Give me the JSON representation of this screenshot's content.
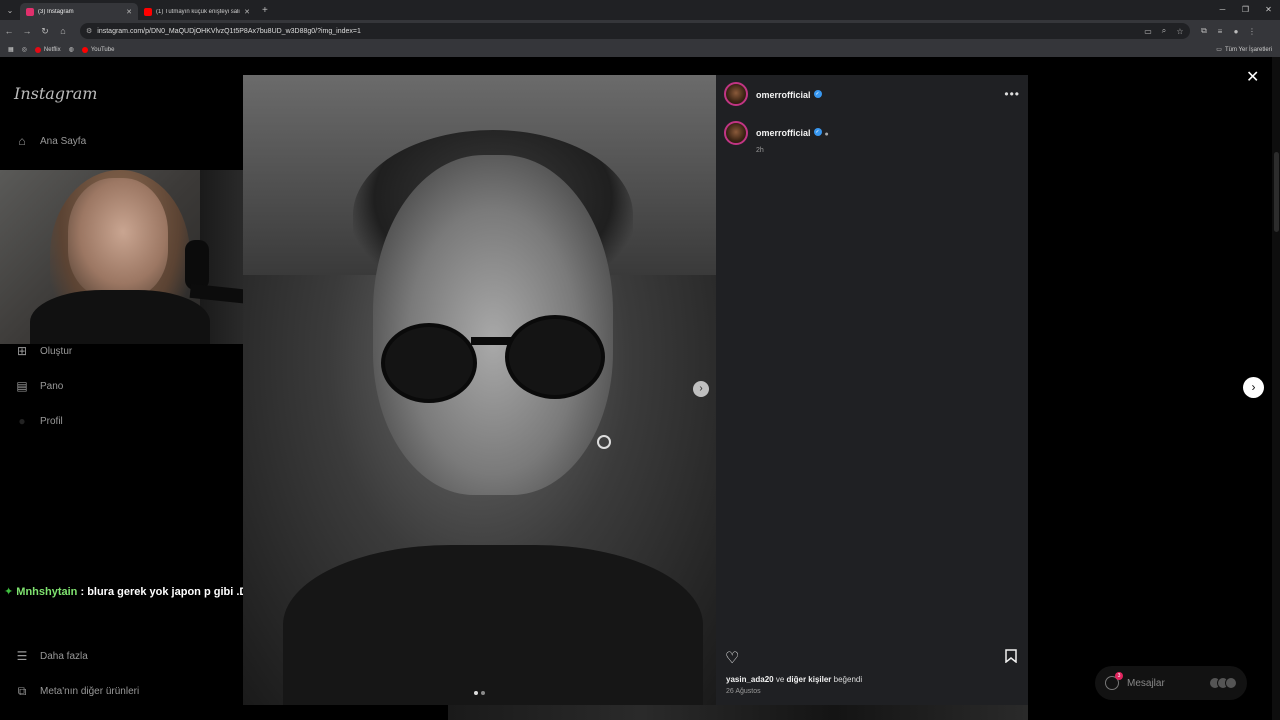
{
  "browser": {
    "tabs": [
      {
        "title": "(3) Instagram",
        "color": "#e1306c"
      },
      {
        "title": "(1) Tutmayın küçük enişteyi sali",
        "color": "#ff0000"
      }
    ],
    "url": "instagram.com/p/DN0_MaQUDjOHKVlvzQ1t5P8Ax7bu8UD_w3D88g0/?img_index=1",
    "bookmarks": [
      {
        "label": "Netflix",
        "color": "#e50914"
      },
      {
        "label": "YouTube",
        "color": "#ff0000"
      }
    ],
    "all_bookmarks": "Tüm Yer İşaretleri"
  },
  "sidebar": {
    "logo": "Instagram",
    "items": [
      {
        "label": "Ana Sayfa",
        "icon": "home-icon"
      },
      {
        "label": "Oluştur",
        "icon": "plus-icon"
      },
      {
        "label": "Pano",
        "icon": "dashboard-icon"
      },
      {
        "label": "Profil",
        "icon": "profile-icon"
      },
      {
        "label": "Daha fazla",
        "icon": "menu-icon"
      },
      {
        "label": "Meta'nın diğer ürünleri",
        "icon": "meta-icon"
      }
    ]
  },
  "chat": {
    "user": "Mnhshytain",
    "message": ": blura gerek yok japon p gibi .D"
  },
  "post": {
    "username": "omerrofficial",
    "caption_username": "omerrofficial",
    "time": "2h",
    "likes_user": "yasin_ada20",
    "likes_mid": " ve ",
    "likes_others": "diğer kişiler",
    "likes_end": " beğendi",
    "date": "26 Ağustos",
    "image_count": 2,
    "image_index": 1
  },
  "messages": {
    "label": "Mesajlar",
    "badge": "3"
  }
}
